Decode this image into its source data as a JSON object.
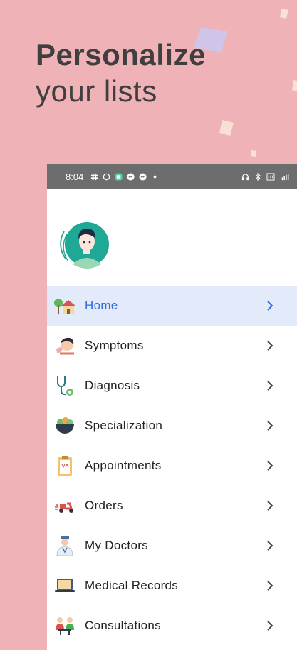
{
  "headline": {
    "line1": "Personalize",
    "line2": "your lists"
  },
  "status_bar": {
    "time": "8:04"
  },
  "colors": {
    "background": "#efb3b7",
    "active_bg": "#e3ebfb",
    "active_text": "#2f6bd8",
    "status_bar": "#6d6d6d"
  },
  "menu": [
    {
      "label": "Home",
      "icon": "home-icon",
      "active": true
    },
    {
      "label": "Symptoms",
      "icon": "symptoms-icon",
      "active": false
    },
    {
      "label": "Diagnosis",
      "icon": "stethoscope-icon",
      "active": false
    },
    {
      "label": "Specialization",
      "icon": "bowl-icon",
      "active": false
    },
    {
      "label": "Appointments",
      "icon": "clipboard-icon",
      "active": false
    },
    {
      "label": "Orders",
      "icon": "delivery-scooter-icon",
      "active": false
    },
    {
      "label": "My Doctors",
      "icon": "doctor-icon",
      "active": false
    },
    {
      "label": "Medical Records",
      "icon": "laptop-icon",
      "active": false
    },
    {
      "label": "Consultations",
      "icon": "consultation-icon",
      "active": false
    }
  ]
}
